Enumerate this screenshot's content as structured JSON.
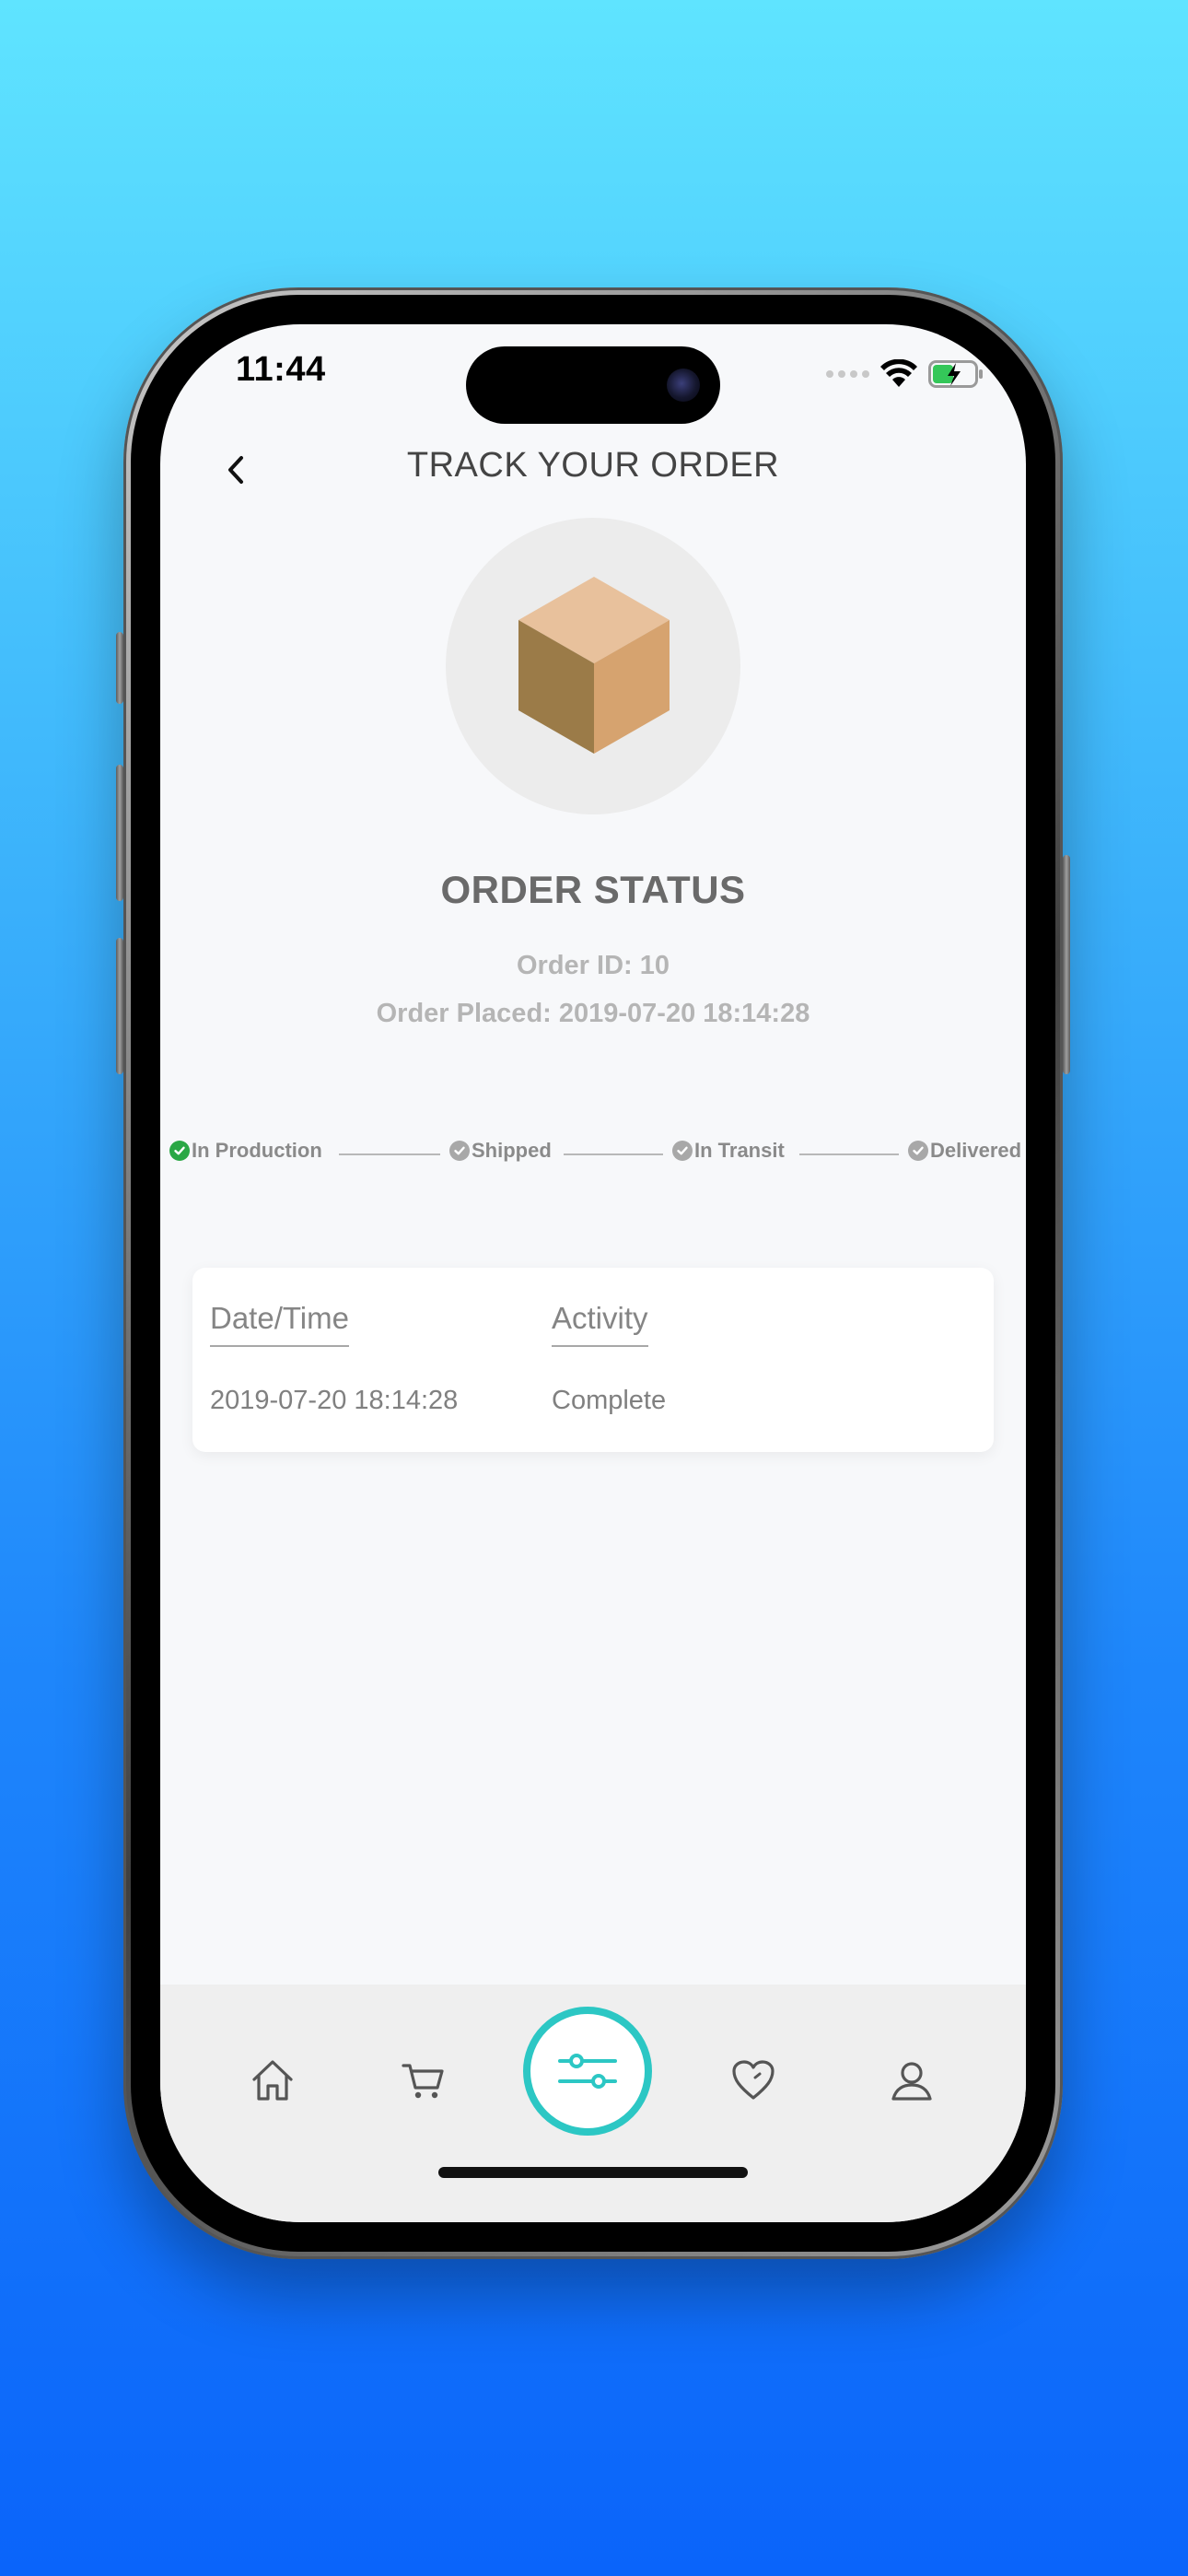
{
  "status_bar": {
    "time": "11:44"
  },
  "header": {
    "title": "TRACK YOUR ORDER",
    "back_icon": "chevron-left-icon"
  },
  "hero": {
    "icon": "package-box-icon"
  },
  "order": {
    "status_heading": "ORDER STATUS",
    "order_id": "Order ID: 10",
    "order_placed": "Order Placed: 2019-07-20 18:14:28"
  },
  "progress": {
    "steps": [
      {
        "label": "In Production",
        "completed": true,
        "color": "#2aa745"
      },
      {
        "label": "Shipped",
        "completed": false,
        "color": "#a8a8a8"
      },
      {
        "label": "In Transit",
        "completed": false,
        "color": "#a8a8a8"
      },
      {
        "label": "Delivered",
        "completed": false,
        "color": "#a8a8a8"
      }
    ]
  },
  "activity_table": {
    "headers": [
      "Date/Time",
      "Activity"
    ],
    "rows": [
      [
        "2019-07-20 18:14:28",
        "Complete"
      ]
    ]
  },
  "bottom_nav": {
    "items": [
      {
        "name": "home-icon"
      },
      {
        "name": "cart-icon"
      },
      {
        "name": "filter-sliders-icon",
        "active": true
      },
      {
        "name": "heart-icon"
      },
      {
        "name": "profile-icon"
      }
    ],
    "accent": "#2cc7c4"
  }
}
